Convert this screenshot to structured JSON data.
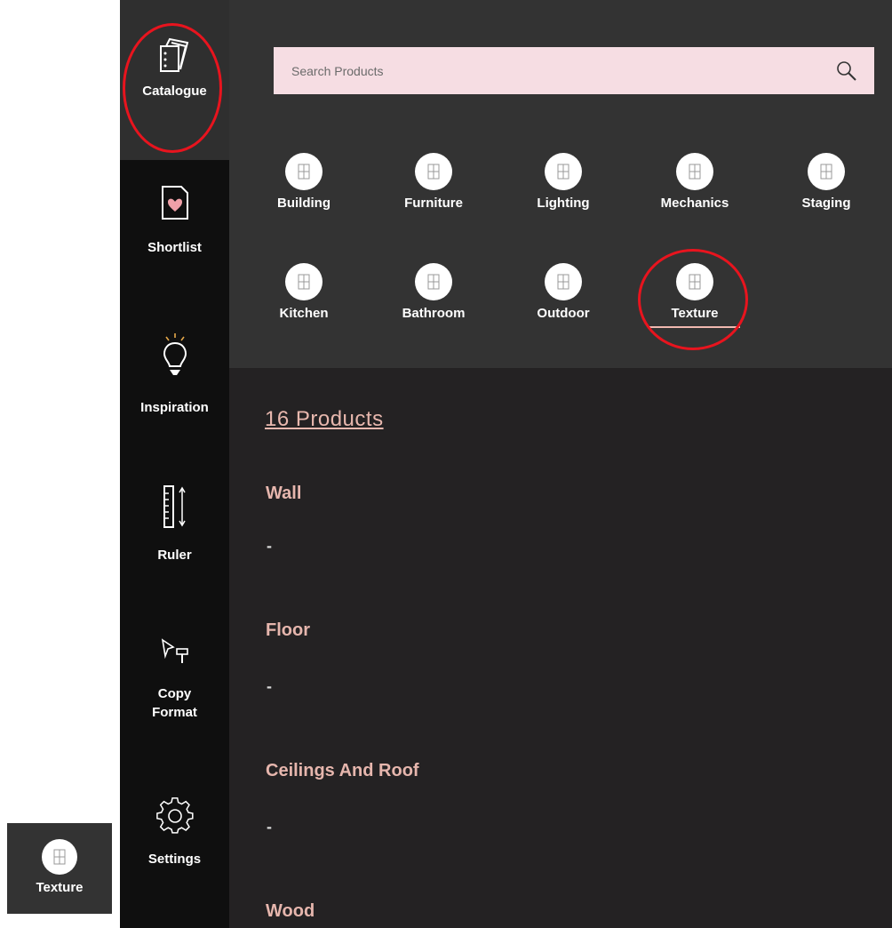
{
  "sidebar": {
    "items": [
      {
        "label": "Catalogue",
        "icon": "catalogue-icon"
      },
      {
        "label": "Shortlist",
        "icon": "shortlist-heart-icon"
      },
      {
        "label": "Inspiration",
        "icon": "lightbulb-icon"
      },
      {
        "label": "Ruler",
        "icon": "ruler-icon"
      },
      {
        "label": "Copy Format",
        "icon": "paint-roller-icon"
      },
      {
        "label": "Settings",
        "icon": "gear-icon"
      }
    ]
  },
  "search": {
    "placeholder": "Search Products",
    "icon": "search-icon"
  },
  "categories": [
    {
      "label": "Building"
    },
    {
      "label": "Furniture"
    },
    {
      "label": "Lighting"
    },
    {
      "label": "Mechanics"
    },
    {
      "label": "Staging"
    },
    {
      "label": "Kitchen"
    },
    {
      "label": "Bathroom"
    },
    {
      "label": "Outdoor"
    },
    {
      "label": "Texture",
      "active": true
    }
  ],
  "results": {
    "count_label": "16 Products",
    "sections": [
      {
        "title": "Wall",
        "placeholder": "-"
      },
      {
        "title": "Floor",
        "placeholder": "-"
      },
      {
        "title": "Ceilings And Roof",
        "placeholder": "-"
      },
      {
        "title": "Wood"
      }
    ]
  },
  "chip": {
    "label": "Texture"
  },
  "colors": {
    "sidebar_bg": "#0f0f0f",
    "panel_bg": "#333333",
    "body_bg": "#242223",
    "search_bg": "#f6dde3",
    "accent_text": "#e6b6ad",
    "annotation": "#e8141e"
  }
}
